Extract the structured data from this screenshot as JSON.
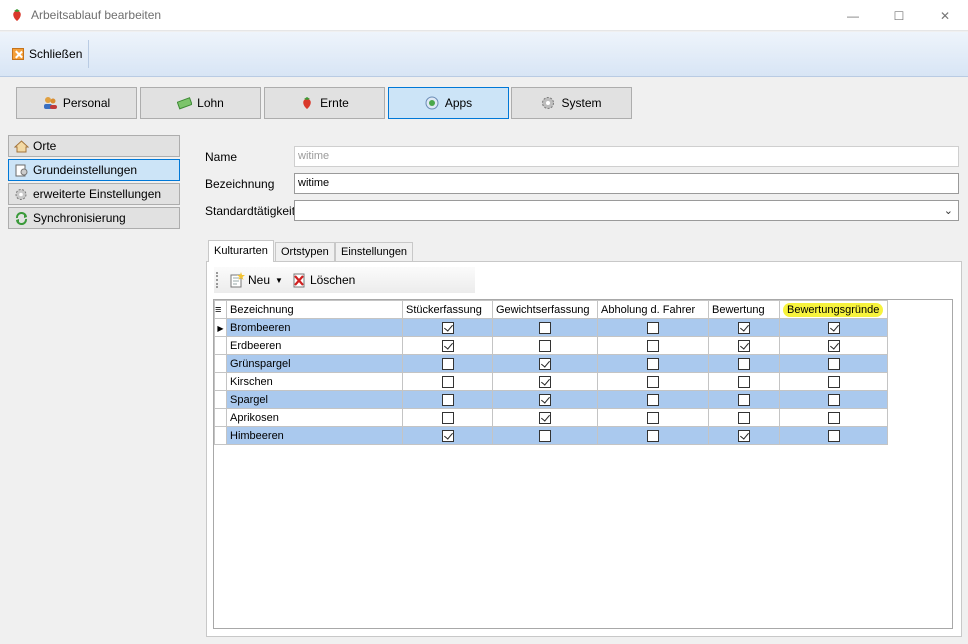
{
  "window": {
    "title": "Arbeitsablauf bearbeiten",
    "controls": {
      "minimize": "—",
      "maximize": "☐",
      "close": "✕"
    }
  },
  "ribbon": {
    "close_label": "Schließen"
  },
  "nav": [
    {
      "label": "Personal",
      "icon": "people-icon"
    },
    {
      "label": "Lohn",
      "icon": "money-icon"
    },
    {
      "label": "Ernte",
      "icon": "strawberry-icon"
    },
    {
      "label": "Apps",
      "icon": "apps-icon",
      "active": true
    },
    {
      "label": "System",
      "icon": "gear-icon"
    }
  ],
  "sidebar": [
    {
      "label": "Orte",
      "icon": "home-icon"
    },
    {
      "label": "Grundeinstellungen",
      "icon": "settings-doc-icon",
      "active": true
    },
    {
      "label": "erweiterte Einstellungen",
      "icon": "gear-icon"
    },
    {
      "label": "Synchronisierung",
      "icon": "sync-icon"
    }
  ],
  "form": {
    "name_label": "Name",
    "name_value": "witime",
    "bezeichnung_label": "Bezeichnung",
    "bezeichnung_value": "witime",
    "standard_label": "Standardtätigkeit",
    "standard_value": ""
  },
  "tabs": [
    "Kulturarten",
    "Ortstypen",
    "Einstellungen"
  ],
  "toolbar": {
    "new_label": "Neu",
    "delete_label": "Löschen"
  },
  "grid": {
    "columns": [
      "Bezeichnung",
      "Stückerfassung",
      "Gewichtserfassung",
      "Abholung d. Fahrer",
      "Bewertung",
      "Bewertungsgründe"
    ],
    "highlight_color": "#f7f33d",
    "selected_row_color": "#aac9ee",
    "rows": [
      {
        "name": "Brombeeren",
        "values": [
          true,
          false,
          false,
          true,
          true
        ],
        "selected": true,
        "current": true
      },
      {
        "name": "Erdbeeren",
        "values": [
          true,
          false,
          false,
          true,
          true
        ],
        "selected": false
      },
      {
        "name": "Grünspargel",
        "values": [
          false,
          true,
          false,
          false,
          false
        ],
        "selected": true
      },
      {
        "name": "Kirschen",
        "values": [
          false,
          true,
          false,
          false,
          false
        ],
        "selected": false
      },
      {
        "name": "Spargel",
        "values": [
          false,
          true,
          false,
          false,
          false
        ],
        "selected": true
      },
      {
        "name": "Aprikosen",
        "values": [
          false,
          true,
          false,
          false,
          false
        ],
        "selected": false
      },
      {
        "name": "Himbeeren",
        "values": [
          true,
          false,
          false,
          true,
          false
        ],
        "selected": true
      }
    ]
  }
}
